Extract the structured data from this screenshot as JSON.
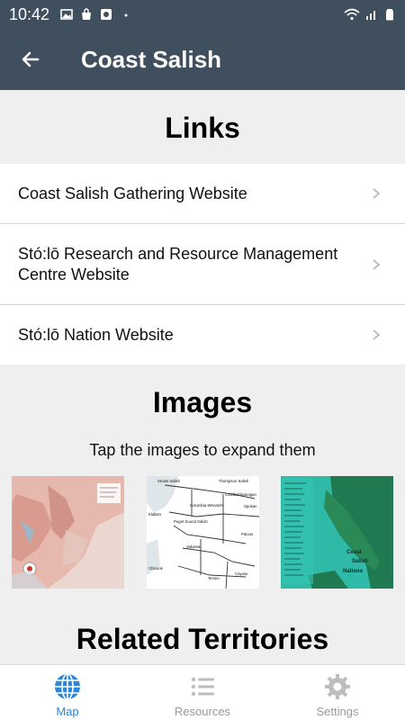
{
  "status_bar": {
    "time": "10:42",
    "icons": [
      "image-icon",
      "bag-icon",
      "app-icon",
      "dot-icon",
      "wifi-icon",
      "signal-icon",
      "battery-icon"
    ]
  },
  "header": {
    "back_icon": "arrow-left-icon",
    "title": "Coast Salish"
  },
  "links": {
    "heading": "Links",
    "items": [
      {
        "label": "Coast Salish Gathering Website"
      },
      {
        "label": "Stó:lō Research and Resource Management Centre Website"
      },
      {
        "label": "Stó:lō Nation Website"
      }
    ]
  },
  "images": {
    "heading": "Images",
    "subtitle": "Tap the images to expand them",
    "map2_labels": [
      "Straits Salish",
      "Thompson Salish",
      "Klallam",
      "Puget Sound Salish",
      "Columbia-Wenatchi",
      "Colville/Okanagan",
      "Spokan",
      "Yakama",
      "Palous",
      "Chinook",
      "Cayuse",
      "Tenino"
    ],
    "map3_labels": [
      "Coast",
      "Salish",
      "Nations"
    ]
  },
  "related": {
    "heading": "Related Territories"
  },
  "bottom_nav": {
    "items": [
      {
        "label": "Map",
        "icon": "globe-icon",
        "active": true
      },
      {
        "label": "Resources",
        "icon": "list-icon",
        "active": false
      },
      {
        "label": "Settings",
        "icon": "gear-icon",
        "active": false
      }
    ]
  },
  "colors": {
    "bar": "#3f4f5e",
    "accent": "#2e86d8",
    "inactive": "#999999"
  }
}
